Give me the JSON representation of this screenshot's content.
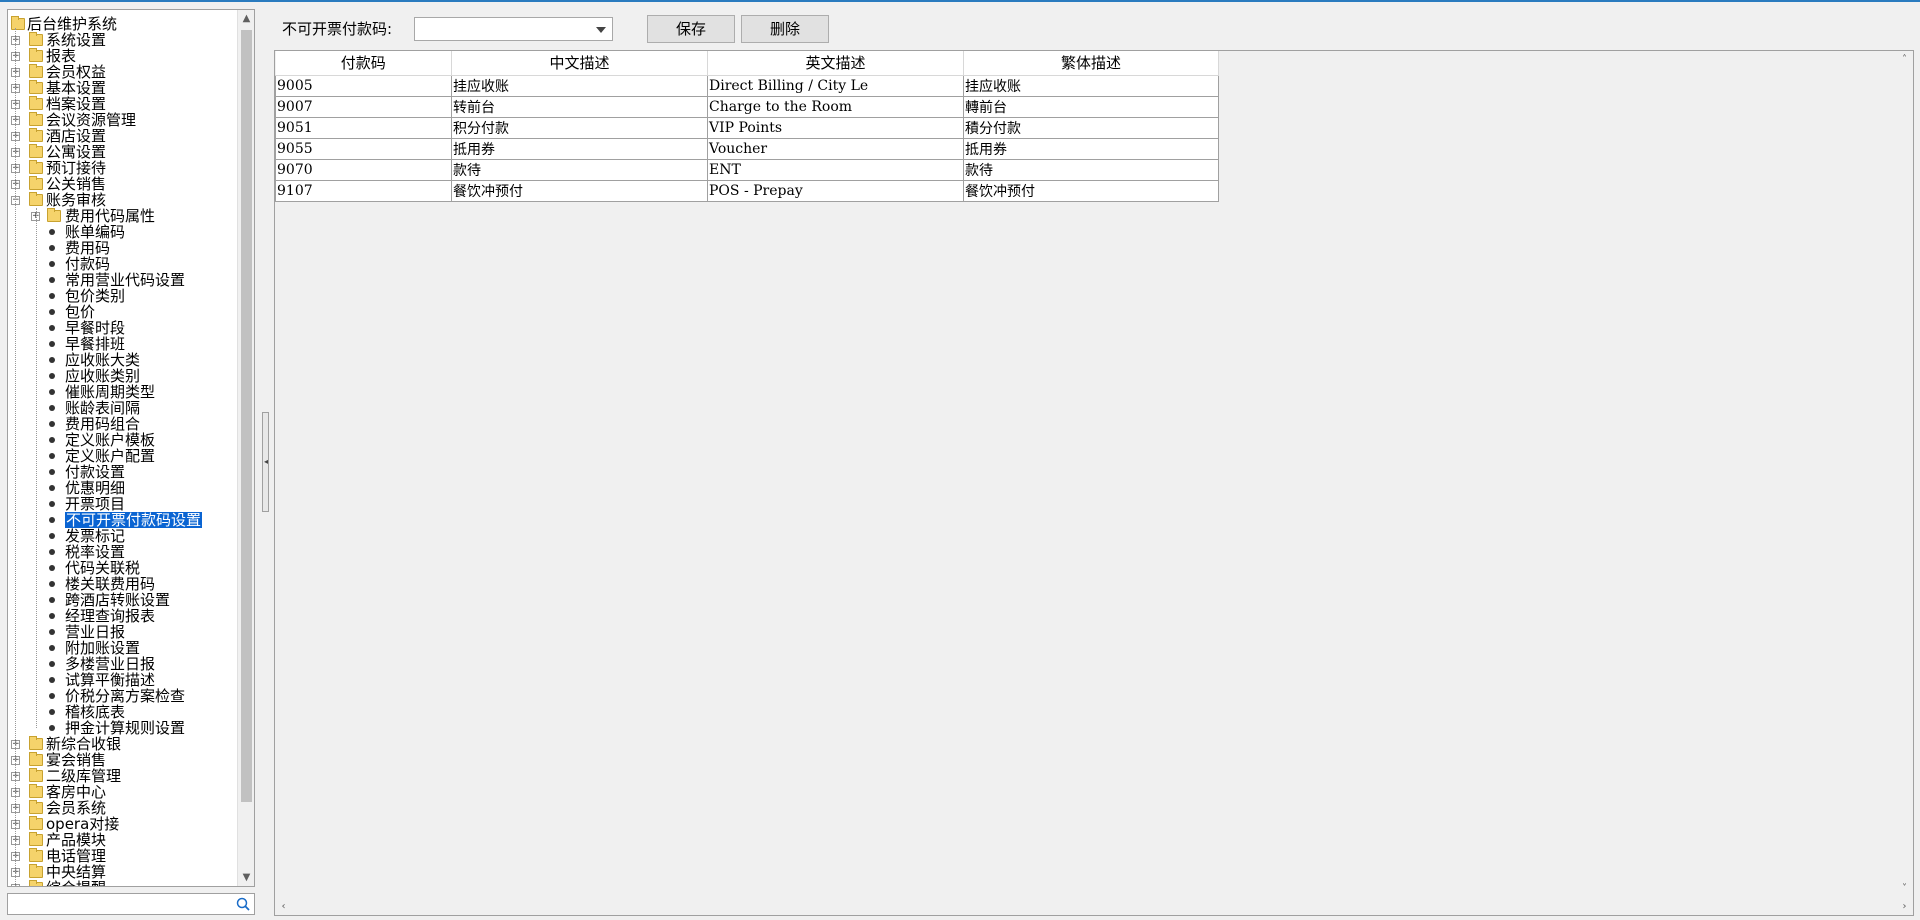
{
  "tree": {
    "root": "后台维护系统",
    "top_items": [
      "系统设置",
      "报表",
      "会员权益",
      "基本设置",
      "档案设置",
      "会议资源管理",
      "酒店设置",
      "公寓设置",
      "预订接待",
      "公关销售",
      "账务审核"
    ],
    "sub_folder": "费用代码属性",
    "children": [
      "账单编码",
      "费用码",
      "付款码",
      "常用营业代码设置",
      "包价类别",
      "包价",
      "早餐时段",
      "早餐排班",
      "应收账大类",
      "应收账类别",
      "催账周期类型",
      "账龄表间隔",
      "费用码组合",
      "定义账户模板",
      "定义账户配置",
      "付款设置",
      "优惠明细",
      "开票项目",
      "不可开票付款码设置",
      "发票标记",
      "税率设置",
      "代码关联税",
      "楼关联费用码",
      "跨酒店转账设置",
      "经理查询报表",
      "营业日报",
      "附加账设置",
      "多楼营业日报",
      "试算平衡描述",
      "价税分离方案检查",
      "稽核底表",
      "押金计算规则设置"
    ],
    "bottom_items": [
      "新综合收银",
      "宴会销售",
      "二级库管理",
      "客房中心",
      "会员系统",
      "opera对接",
      "产品模块",
      "电话管理",
      "中央结算",
      "综合提醒"
    ],
    "selected": "不可开票付款码设置"
  },
  "toolbar": {
    "label": "不可开票付款码:",
    "combo_value": "",
    "save_label": "保存",
    "delete_label": "删除"
  },
  "grid": {
    "headers": [
      "付款码",
      "中文描述",
      "英文描述",
      "繁体描述"
    ],
    "rows": [
      [
        "9005",
        "挂应收账",
        "Direct Billing / City Le",
        "挂应收账"
      ],
      [
        "9007",
        "转前台",
        "Charge to the Room",
        "轉前台"
      ],
      [
        "9051",
        "积分付款",
        "VIP Points",
        "積分付款"
      ],
      [
        "9055",
        "抵用券",
        "Voucher",
        "抵用券"
      ],
      [
        "9070",
        "款待",
        "ENT",
        "款待"
      ],
      [
        "9107",
        "餐饮冲预付",
        "POS - Prepay",
        "餐饮冲预付"
      ]
    ]
  },
  "colors": {
    "selection": "#0a64d2",
    "folder": "#f5d36b",
    "top_border": "#2a7bbf"
  }
}
